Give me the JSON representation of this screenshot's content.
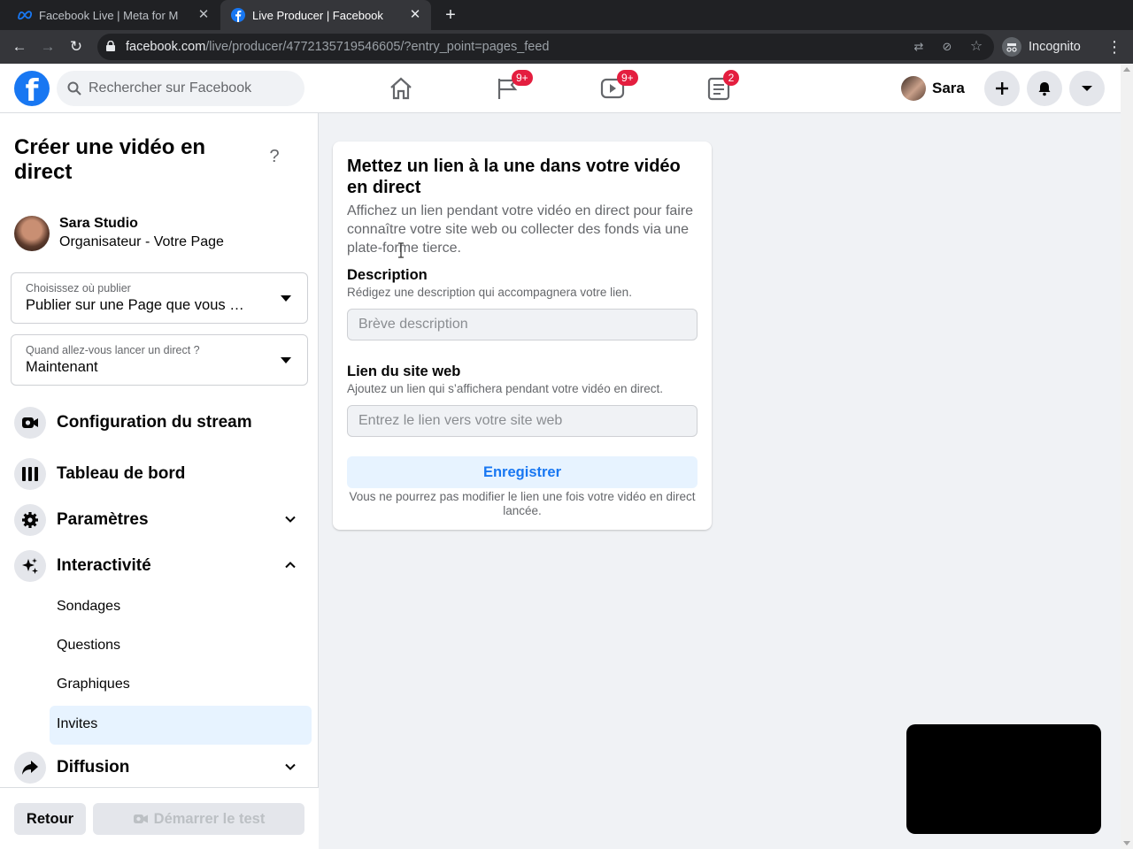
{
  "browser": {
    "tabs": [
      {
        "title": "Facebook Live | Meta for M",
        "active": false
      },
      {
        "title": "Live Producer | Facebook",
        "active": true
      }
    ],
    "url_host": "facebook.com",
    "url_path": "/live/producer/4772135719546605/?entry_point=pages_feed",
    "incognito_label": "Incognito"
  },
  "fb_header": {
    "search_placeholder": "Rechercher sur Facebook",
    "badges": {
      "pages": "9+",
      "watch": "9+",
      "news": "2"
    },
    "profile_name": "Sara"
  },
  "sidebar": {
    "title": "Créer une vidéo en direct",
    "help": "?",
    "owner_name": "Sara Studio",
    "owner_role": "Organisateur - Votre Page",
    "publish_select": {
      "label": "Choisissez où publier",
      "value": "Publier sur une Page que vous …"
    },
    "when_select": {
      "label": "Quand allez-vous lancer un direct ?",
      "value": "Maintenant"
    },
    "menu": [
      {
        "label": "Configuration du stream"
      },
      {
        "label": "Tableau de bord"
      },
      {
        "label": "Paramètres"
      },
      {
        "label": "Interactivité"
      }
    ],
    "submenu": [
      {
        "label": "Sondages"
      },
      {
        "label": "Questions"
      },
      {
        "label": "Graphiques"
      },
      {
        "label": "Invites",
        "active": true
      }
    ],
    "menu_after": {
      "label": "Diffusion"
    },
    "footer": {
      "back_label": "Retour",
      "test_label": "Démarrer le test"
    }
  },
  "card": {
    "title": "Mettez un lien à la une dans votre vidéo en direct",
    "description": "Affichez un lien pendant votre vidéo en direct pour faire connaître votre site web ou collecter des fonds via une plate-forme tierce.",
    "desc_field": {
      "label": "Description",
      "help": "Rédigez une description qui accompagnera votre lien.",
      "placeholder": "Brève description",
      "value": ""
    },
    "link_field": {
      "label": "Lien du site web",
      "help": "Ajoutez un lien qui s’affichera pendant votre vidéo en direct.",
      "placeholder": "Entrez le lien vers votre site web",
      "value": ""
    },
    "save_label": "Enregistrer",
    "note": "Vous ne pourrez pas modifier le lien une fois votre vidéo en direct lancée."
  },
  "colors": {
    "brand": "#1877f2",
    "badge": "#e41e3f",
    "active_bg": "#e7f3ff"
  }
}
